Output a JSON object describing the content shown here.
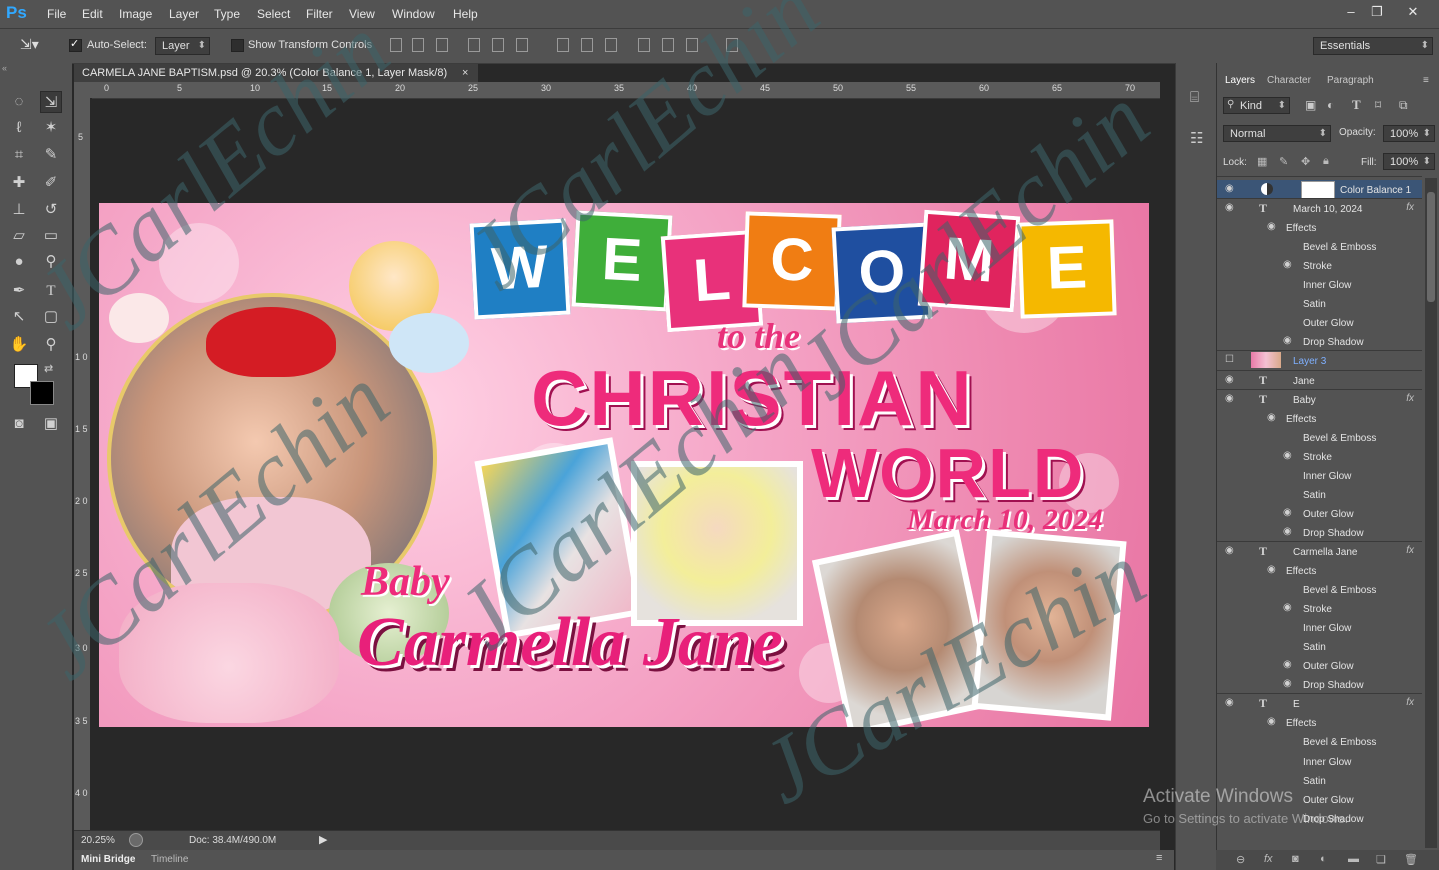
{
  "menubar": {
    "logo": "Ps",
    "items": [
      "File",
      "Edit",
      "Image",
      "Layer",
      "Type",
      "Select",
      "Filter",
      "View",
      "Window",
      "Help"
    ],
    "window_buttons": [
      "–",
      "❐",
      "✕"
    ]
  },
  "options_bar": {
    "auto_select_label": "Auto-Select:",
    "auto_select_checked": true,
    "auto_select_target": "Layer",
    "show_transform_label": "Show Transform Controls",
    "workspace": "Essentials"
  },
  "document": {
    "tab_title": "CARMELA JANE BAPTISM.psd @ 20.3% (Color Balance 1, Layer Mask/8)",
    "close_glyph": "×",
    "ruler_top": [
      "0",
      "5",
      "10",
      "15",
      "20",
      "25",
      "30",
      "35",
      "40",
      "45",
      "50",
      "55",
      "60",
      "65",
      "70"
    ],
    "ruler_left": [
      "5",
      "1 0",
      "1 5",
      "2 0",
      "2 5",
      "3 0",
      "3 5",
      "4 0"
    ],
    "zoom": "20.25%",
    "doc_size": "Doc: 38.4M/490.0M"
  },
  "bottom_tabs": [
    "Mini Bridge",
    "Timeline"
  ],
  "artwork": {
    "welcome_letters": [
      "W",
      "E",
      "L",
      "C",
      "O",
      "M",
      "E"
    ],
    "welcome_colors": [
      "#1f7fc4",
      "#3fae3a",
      "#e8317a",
      "#f07d13",
      "#1f4fa0",
      "#e0245e",
      "#f5b800"
    ],
    "to_the": "to the",
    "christian": "CHRISTIAN",
    "world": "WORLD",
    "date": "March 10, 2024",
    "baby": "Baby",
    "name": "Carmella Jane"
  },
  "panel": {
    "tabs": [
      "Layers",
      "Character",
      "Paragraph"
    ],
    "kind_label": "Kind",
    "blend_mode": "Normal",
    "opacity_label": "Opacity:",
    "opacity_value": "100%",
    "lock_label": "Lock:",
    "fill_label": "Fill:",
    "fill_value": "100%",
    "layers": [
      {
        "label": "Color Balance 1",
        "type": "adjustment",
        "selected": true
      },
      {
        "label": "March 10, 2024",
        "type": "text",
        "fx": "fx"
      },
      {
        "label": "Effects",
        "type": "effects-header"
      },
      {
        "label": "Bevel & Emboss",
        "type": "effect"
      },
      {
        "label": "Stroke",
        "type": "effect",
        "eye": true
      },
      {
        "label": "Inner Glow",
        "type": "effect"
      },
      {
        "label": "Satin",
        "type": "effect"
      },
      {
        "label": "Outer Glow",
        "type": "effect"
      },
      {
        "label": "Drop Shadow",
        "type": "effect",
        "eye": true
      },
      {
        "label": "Layer 3",
        "type": "image"
      },
      {
        "label": "Jane",
        "type": "text"
      },
      {
        "label": "Baby",
        "type": "text",
        "fx": "fx"
      },
      {
        "label": "Effects",
        "type": "effects-header"
      },
      {
        "label": "Bevel & Emboss",
        "type": "effect"
      },
      {
        "label": "Stroke",
        "type": "effect",
        "eye": true
      },
      {
        "label": "Inner Glow",
        "type": "effect"
      },
      {
        "label": "Satin",
        "type": "effect"
      },
      {
        "label": "Outer Glow",
        "type": "effect",
        "eye": true
      },
      {
        "label": "Drop Shadow",
        "type": "effect",
        "eye": true
      },
      {
        "label": "Carmella Jane",
        "type": "text",
        "fx": "fx"
      },
      {
        "label": "Effects",
        "type": "effects-header"
      },
      {
        "label": "Bevel & Emboss",
        "type": "effect"
      },
      {
        "label": "Stroke",
        "type": "effect",
        "eye": true
      },
      {
        "label": "Inner Glow",
        "type": "effect"
      },
      {
        "label": "Satin",
        "type": "effect"
      },
      {
        "label": "Outer Glow",
        "type": "effect",
        "eye": true
      },
      {
        "label": "Drop Shadow",
        "type": "effect",
        "eye": true
      },
      {
        "label": "E",
        "type": "text",
        "fx": "fx"
      },
      {
        "label": "Effects",
        "type": "effects-header"
      },
      {
        "label": "Bevel & Emboss",
        "type": "effect"
      },
      {
        "label": "Inner Glow",
        "type": "effect"
      },
      {
        "label": "Satin",
        "type": "effect"
      },
      {
        "label": "Outer Glow",
        "type": "effect"
      },
      {
        "label": "Drop Shadow",
        "type": "effect"
      }
    ],
    "footer_icons": [
      "link-icon",
      "fx-icon",
      "mask-icon",
      "adjustment-icon",
      "folder-icon",
      "new-layer-icon",
      "trash-icon"
    ]
  },
  "activation": {
    "title": "Activate Windows",
    "subtitle": "Go to Settings to activate Windows."
  },
  "watermark": "JCarlEchin"
}
